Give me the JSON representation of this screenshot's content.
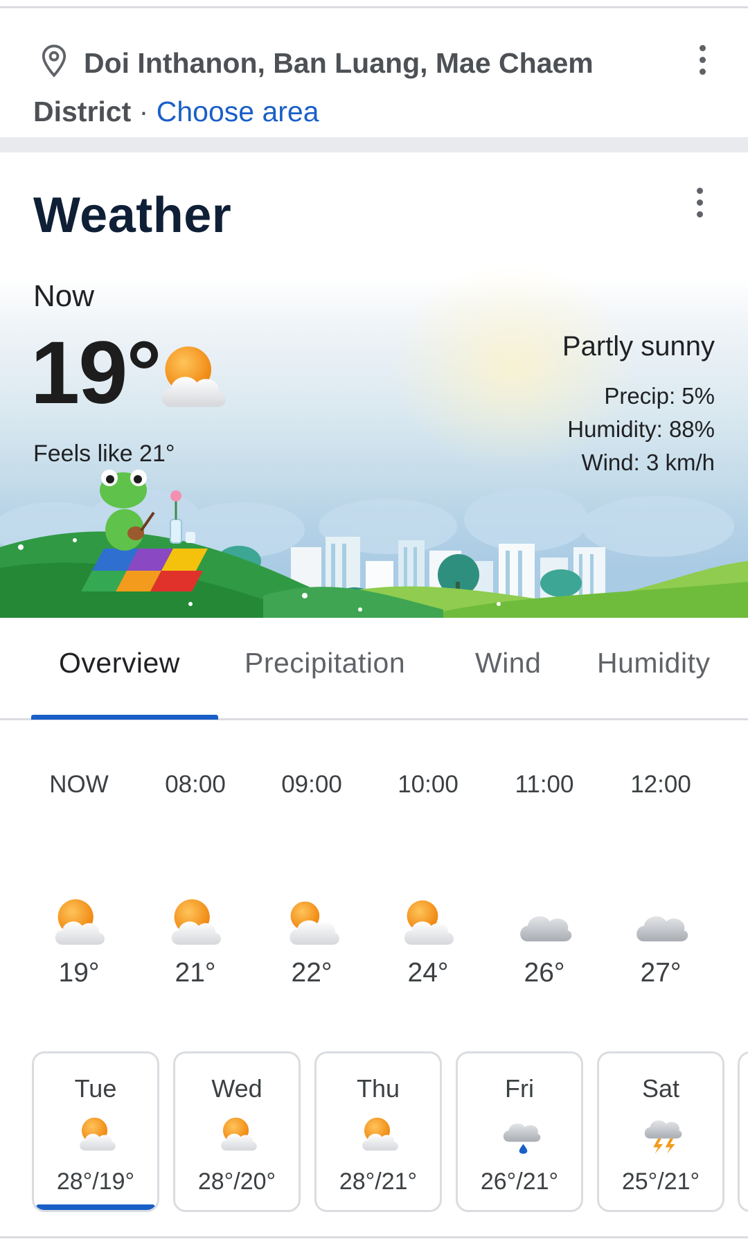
{
  "location": {
    "place": "Doi Inthanon, Ban Luang, Mae Chaem District",
    "separator": "·",
    "choose_area_label": "Choose area",
    "icons": {
      "pin": "location-pin-icon",
      "menu": "more-vert-icon"
    }
  },
  "weather": {
    "title": "Weather",
    "now_label": "Now",
    "temperature": "19°",
    "feels_like": "Feels like 21°",
    "condition": "Partly sunny",
    "condition_icon": "partly-sunny-icon",
    "precip": "Precip: 5%",
    "humidity": "Humidity: 88%",
    "wind": "Wind: 3 km/h"
  },
  "tabs": [
    {
      "label": "Overview",
      "active": true
    },
    {
      "label": "Precipitation",
      "active": false
    },
    {
      "label": "Wind",
      "active": false
    },
    {
      "label": "Humidity",
      "active": false
    }
  ],
  "hourly": [
    {
      "time": "NOW",
      "temp": "19°",
      "icon": "partly-sunny"
    },
    {
      "time": "08:00",
      "temp": "21°",
      "icon": "partly-sunny"
    },
    {
      "time": "09:00",
      "temp": "22°",
      "icon": "mostly-cloudy"
    },
    {
      "time": "10:00",
      "temp": "24°",
      "icon": "partly-sunny"
    },
    {
      "time": "11:00",
      "temp": "26°",
      "icon": "cloudy"
    },
    {
      "time": "12:00",
      "temp": "27°",
      "icon": "cloudy"
    }
  ],
  "daily": [
    {
      "day": "Tue",
      "temps": "28°/19°",
      "icon": "partly-sunny",
      "selected": true
    },
    {
      "day": "Wed",
      "temps": "28°/20°",
      "icon": "partly-sunny",
      "selected": false
    },
    {
      "day": "Thu",
      "temps": "28°/21°",
      "icon": "partly-sunny",
      "selected": false
    },
    {
      "day": "Fri",
      "temps": "26°/21°",
      "icon": "rain",
      "selected": false
    },
    {
      "day": "Sat",
      "temps": "25°/21°",
      "icon": "thunderstorm",
      "selected": false
    }
  ],
  "colors": {
    "accent_blue": "#1a5fc7",
    "sun_orange": "#f29b1c",
    "grass_green": "#2e9a3f"
  }
}
